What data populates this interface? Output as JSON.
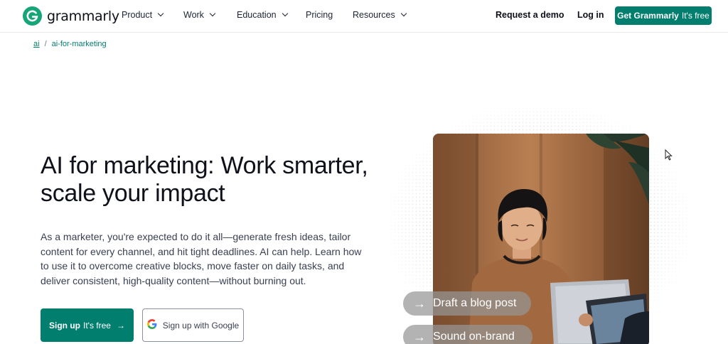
{
  "brand": {
    "name": "grammarly",
    "color": "#15a578"
  },
  "nav": {
    "items": [
      {
        "label": "Product",
        "dropdown": true
      },
      {
        "label": "Work",
        "dropdown": true
      },
      {
        "label": "Education",
        "dropdown": true
      },
      {
        "label": "Pricing",
        "dropdown": false
      },
      {
        "label": "Resources",
        "dropdown": true
      }
    ],
    "request_demo": "Request a demo",
    "login": "Log in",
    "cta": {
      "strong": "Get Grammarly",
      "light": "It's free"
    }
  },
  "breadcrumb": {
    "root": "ai",
    "separator": "/",
    "current": "ai-for-marketing"
  },
  "hero": {
    "title": "AI for marketing: Work smarter, scale your impact",
    "body": "As a marketer, you're expected to do it all—generate fresh ideas, tailor content for every channel, and hit tight deadlines. AI can help. Learn how to use it to overcome creative blocks, move faster on daily tasks, and deliver consistent, high-quality content—without burning out.",
    "signup": {
      "strong": "Sign up",
      "light": "It's free",
      "arrow": "→"
    },
    "google": "Sign up with Google"
  },
  "pills": [
    {
      "arrow": "→",
      "label": "Draft a blog post"
    },
    {
      "arrow": "→",
      "label": "Sound on-brand"
    }
  ],
  "colors": {
    "accent": "#027e6f",
    "text": "#0e101a"
  }
}
